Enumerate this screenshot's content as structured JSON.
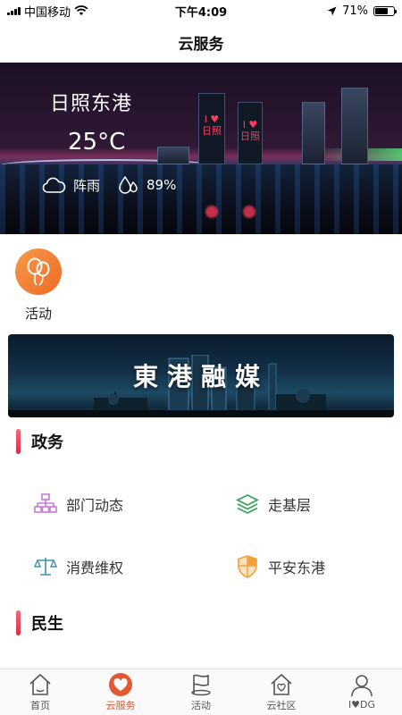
{
  "status_bar": {
    "carrier": "中国移动",
    "time": "下午4:09",
    "battery_percent": "71%",
    "battery_level": 0.71,
    "icons": [
      "signal-icon",
      "wifi-icon",
      "location-arrow-icon",
      "battery-icon"
    ]
  },
  "nav": {
    "title": "云服务"
  },
  "weather": {
    "city": "日照东港",
    "temperature": "25°C",
    "condition": "阵雨",
    "humidity": "89%",
    "banner_sign_left": "I ♥ 日照",
    "banner_sign_right": "I ♥ 日照",
    "icons": [
      "cloud-icon",
      "humidity-drops-icon"
    ]
  },
  "activity": {
    "label": "活动",
    "icon": "balloons-icon",
    "color": "#f07a30"
  },
  "promo_banner": {
    "title": "東港融媒"
  },
  "sections": {
    "government": {
      "title": "政务",
      "items": [
        {
          "label": "部门动态",
          "icon": "org-chart-icon",
          "color": "#c77ad6"
        },
        {
          "label": "走基层",
          "icon": "layers-icon",
          "color": "#3aa55a"
        },
        {
          "label": "消费维权",
          "icon": "scales-icon",
          "color": "#3d8fb3"
        },
        {
          "label": "平安东港",
          "icon": "shield-icon",
          "color": "#f0a23c"
        }
      ]
    },
    "livelihood": {
      "title": "民生"
    }
  },
  "tab_bar": {
    "active_color": "#e05a33",
    "tabs": [
      {
        "label": "首页",
        "icon": "home-icon"
      },
      {
        "label": "云服务",
        "icon": "heart-icon"
      },
      {
        "label": "活动",
        "icon": "flag-icon"
      },
      {
        "label": "云社区",
        "icon": "community-house-icon"
      },
      {
        "label": "I♥DG",
        "icon": "person-icon"
      }
    ]
  }
}
